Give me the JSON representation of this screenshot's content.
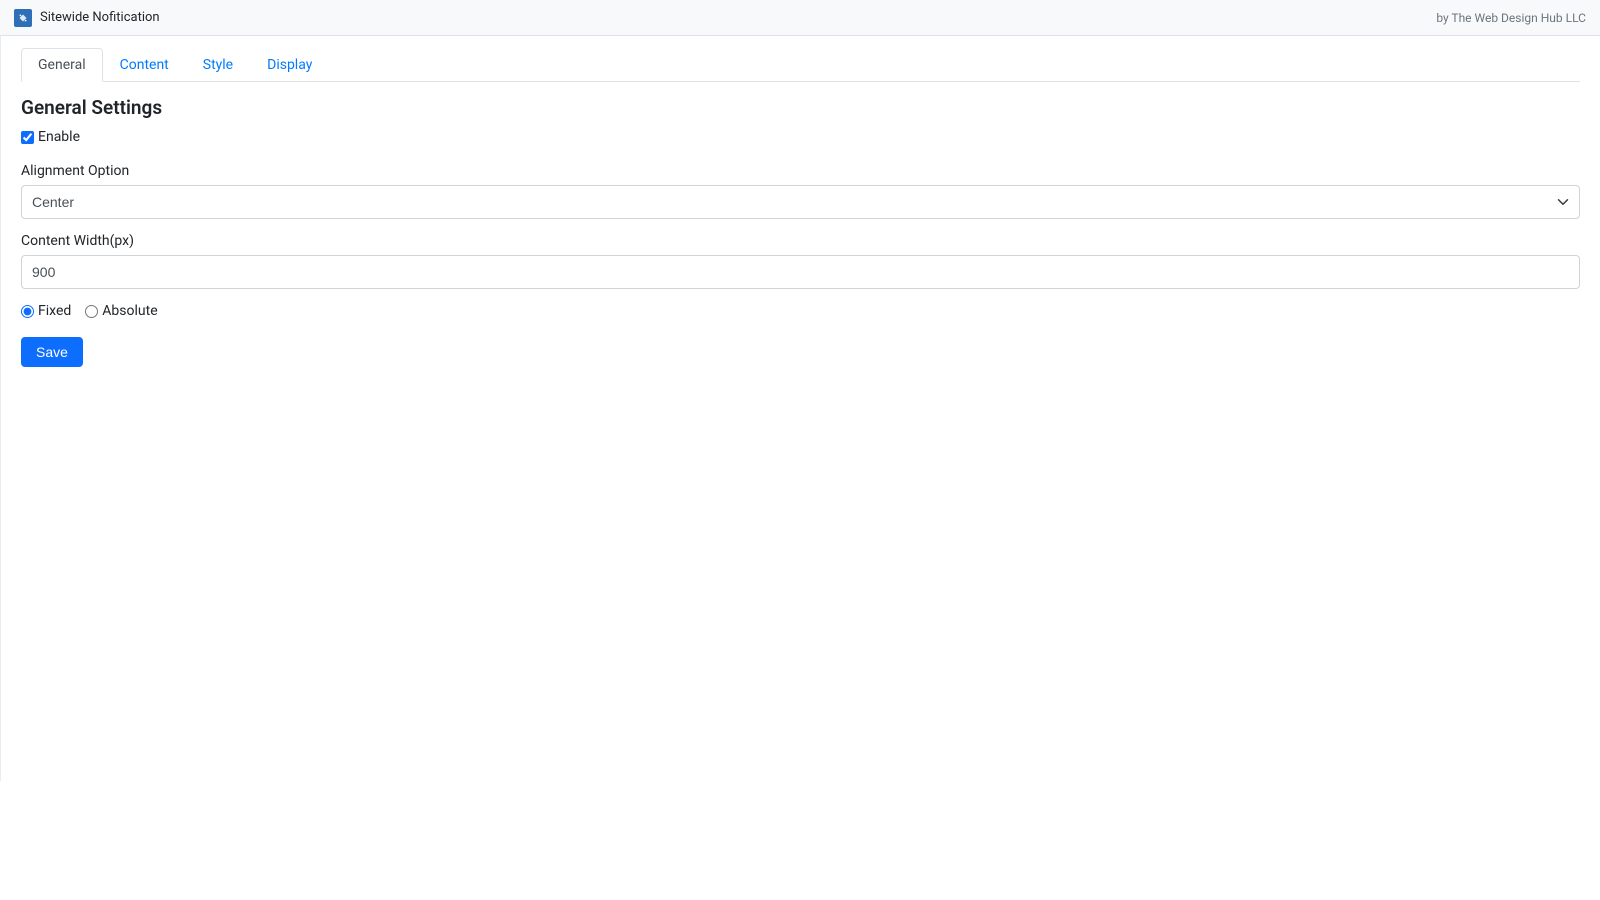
{
  "header": {
    "app_title": "Sitewide Nofitication",
    "byline": "by The Web Design Hub LLC"
  },
  "tabs": [
    {
      "label": "General",
      "active": true
    },
    {
      "label": "Content",
      "active": false
    },
    {
      "label": "Style",
      "active": false
    },
    {
      "label": "Display",
      "active": false
    }
  ],
  "page": {
    "heading": "General Settings",
    "enable": {
      "label": "Enable",
      "checked": true
    },
    "alignment": {
      "label": "Alignment Option",
      "value": "Center"
    },
    "content_width": {
      "label": "Content Width(px)",
      "value": "900"
    },
    "position": {
      "fixed_label": "Fixed",
      "absolute_label": "Absolute",
      "selected": "fixed"
    },
    "save_button": "Save"
  }
}
